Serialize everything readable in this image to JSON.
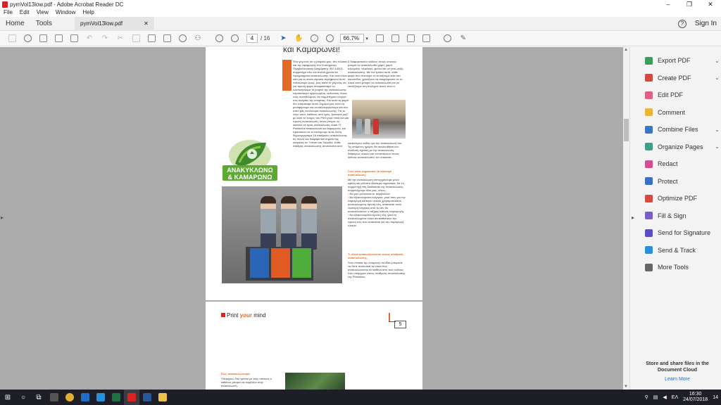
{
  "window": {
    "title": "pymVol13low.pdf - Adobe Acrobat Reader DC",
    "minimize": "–",
    "maximize": "❐",
    "close": "✕"
  },
  "menu": [
    "File",
    "Edit",
    "View",
    "Window",
    "Help"
  ],
  "tabs": {
    "home": "Home",
    "tools": "Tools",
    "document": "pymVol13low.pdf",
    "close": "✕",
    "help": "?",
    "signin": "Sign In"
  },
  "toolbar": {
    "page_current": "4",
    "page_total": "/ 16",
    "zoom": "66.7%"
  },
  "document": {
    "page1_heading": "και Καμαρώνει!",
    "col1_text": "Ένα γεγονός ότι η εταιρεία μας, στο πλαίσιο και της εφαρμογής του Συστήματος Περιβαλλοντικής Διαχείρισης ISO 14001, συμμετέχει εδώ και πολλά χρόνια σε προγράμματα ανακύκλωσης. Και αυτό είναι κάτι για το οποίο είμαστε περήφανοι! Αυτό πιστεύουμε όμως, μας κάνει το γεγονός ότι για πρώτη φορά αποφασίσαμε να υλοποιήσουμε το project της ανακύκλωσης περισσότερο οργανωμένα, καλώντας όλους τους συναδέλφους να συμμετέχουν ενεργά στις ανάγκες της εταιρείας. Και αυτό τη φορά δεν σταματάμε αυτό! Σήμερα μας είναι να μεταφέρουμε και να καλλιεργήσουμε και στο σπίτι μας κουλτούρα ανακύκλωσης. Για το λόγο αυτό, καθένας από εμάς, ξεκίνησε μαζί με αυτό το τεύχος του Print your mind και μία πρώτη ανακύκλωση, όπου μπορεί να καλέσει σε προς ανακύκλωση υλικά. Η Pressious ανακυκλώνει και καμαρώνει, και προσκαλεί να το πετύχουμε αυτό. Άλλη δημιουργήσαμε 16 σταθμούς ανακύκλωσης σε πολλά και διαφορετικά σημεία της εταιρείας σε Ύτσσπ και Χαλκίδα. Κάθε σταθμός ανακύκλωσης αποτελείται από",
    "col2_text": "3 διαφορετικούς κάδους στους οποίους μπορεί να ανακυκλωθεί χαρτί, χαρτί, αλουμίνιο, πλαστικό, φελλό και να γίνει μείζη ανακύκλωσης. Με τον τρόπο αυτό, κάθε φορά που πάνουμε να πετάξουμε κάτι στα σκουπίδια, χρειάζεται να σκεφτόμαστε αν το υλικό αυτό μπορεί να ανακυκλωθεί και να επιλέξουμε στη συνέχεια ποιος είναι ο",
    "col2_text2": "κατάλληλος κάδος για την ανακύκλωσή του. Τις επόμενες ημέρες θα ακολουθήσει και ανάλυση σχετική με την ανακύκλωση διάφορων υλικών και συνιστάσεων στους κάδους ανακύκλωσης της εταιρείας.",
    "sub1": "Γιατί είναι σημαντικό να κάνουμε ανακύκλωση;",
    "sub1_text": "Με την ανακύκλωση επιτυγχάνουμε μόνο οφέλη και μάλιστα ιδιαίτερα σημαντικά. Με τη συμμετοχή στη διαδικασία της ανακύκλωσης, συμμετέχουμε όλοι μας, όπως:",
    "bullets": [
      "Να μην μολύνεται το περιβάλλον",
      "Να εξοικονομείται ενέργεια, γιατί όταν για την παραγωγή κάποιου υλικού χρησιμοποιείται ανακυκλωμένη πρώτη ύλη, απαιτείται πολύ λιγότερη ενέργεια από το εάν θα ανακυκλώσουν ο ταξίμης κάκους παραγωγής",
      "Να εξοικονομείται πρώτη ύλη, γιατί τα ανακυκλωμένα υλικά αντικαθιστούν την πρώτη ύλη που απαιτείται για την παραγωγή υλικών."
    ],
    "sub2": "Τι υλικά ανακυκλώνονται στους σταθμούς ανακύκλωσης;",
    "sub2_text": "Στον πίνακα της επόμενης σελίδας μπορείτε να δείτε αναλυτικά τα υλικά που ανακυκλώνονται σε καθένα από τους κάδους που υπάρχουν στους σταθμούς ανακύκλωσης της Pressious.",
    "logo_line1": "ΑΝΑΚΥΚΛΩΝΩ",
    "logo_line2": "& ΚΑΜΑΡΩΝΩ",
    "bin_labels": [
      "Ανακύκλωση",
      "Ανακύκλωση",
      "Ανακύκλωση"
    ],
    "page2_title_a": "Print ",
    "page2_title_b": "your",
    "page2_title_c": " mind",
    "page2_number": "5",
    "page2_sub": "Πώς ανακυκλώνουμε;",
    "page2_text": "Υπάρχουν δύο τρόποι με τους οποίους ο καθένας μπορεί να συμβάλει στην ανακύκλωση."
  },
  "right_panel": {
    "tools": [
      {
        "label": "Export PDF",
        "icon": "export-pdf-icon",
        "color": "#3a9e5a",
        "chevron": "⌄"
      },
      {
        "label": "Create PDF",
        "icon": "create-pdf-icon",
        "color": "#d9473f",
        "chevron": "⌄"
      },
      {
        "label": "Edit PDF",
        "icon": "edit-pdf-icon",
        "color": "#e05f84",
        "chevron": ""
      },
      {
        "label": "Comment",
        "icon": "comment-icon",
        "color": "#e8b63a",
        "chevron": ""
      },
      {
        "label": "Combine Files",
        "icon": "combine-files-icon",
        "color": "#3a76c4",
        "chevron": "⌄"
      },
      {
        "label": "Organize Pages",
        "icon": "organize-pages-icon",
        "color": "#3aa18a",
        "chevron": "⌄"
      },
      {
        "label": "Redact",
        "icon": "redact-icon",
        "color": "#d54f8f",
        "chevron": ""
      },
      {
        "label": "Protect",
        "icon": "protect-icon",
        "color": "#3a6fc8",
        "chevron": ""
      },
      {
        "label": "Optimize PDF",
        "icon": "optimize-pdf-icon",
        "color": "#d9473f",
        "chevron": ""
      },
      {
        "label": "Fill & Sign",
        "icon": "fill-sign-icon",
        "color": "#7b5cc9",
        "chevron": ""
      },
      {
        "label": "Send for Signature",
        "icon": "send-for-signature-icon",
        "color": "#5a4fc2",
        "chevron": ""
      },
      {
        "label": "Send & Track",
        "icon": "send-track-icon",
        "color": "#2a8fd8",
        "chevron": ""
      },
      {
        "label": "More Tools",
        "icon": "more-tools-icon",
        "color": "#666666",
        "chevron": ""
      }
    ],
    "cloud_text": "Store and share files in the Document Cloud",
    "learn_more": "Learn More"
  },
  "taskbar": {
    "lang": "ΕΛ",
    "time": "16:30",
    "date": "24/07/2018",
    "notif": "14"
  }
}
